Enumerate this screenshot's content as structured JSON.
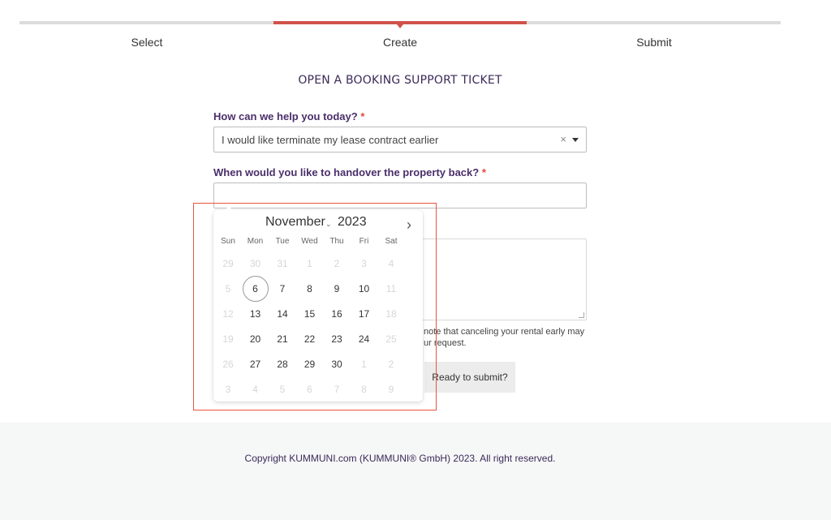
{
  "steps": [
    {
      "label": "Select",
      "active": false
    },
    {
      "label": "Create",
      "active": true
    },
    {
      "label": "Submit",
      "active": false
    }
  ],
  "colors": {
    "accent": "#d0524a",
    "heading": "#3b2a58",
    "label": "#4a2f6a",
    "required": "#e04a3a",
    "annotation": "#e8553e"
  },
  "form": {
    "title": "OPEN A BOOKING SUPPORT TICKET",
    "help_label": "How can we help you today?",
    "help_required": "*",
    "help_value": "I would like terminate my lease contract earlier",
    "help_clear_icon": "×",
    "handover_label": "When would you like to handover the property back?",
    "handover_required": "*",
    "handover_value": "",
    "note_text": "note that canceling your rental early may",
    "note_text_2": "ur request.",
    "submit_label": "Ready to submit?"
  },
  "calendar": {
    "month": "November",
    "month_caret": "⌄",
    "year": "2023",
    "next_icon": "›",
    "weekdays": [
      "Sun",
      "Mon",
      "Tue",
      "Wed",
      "Thu",
      "Fri",
      "Sat"
    ],
    "weeks": [
      [
        {
          "d": "29",
          "m": true
        },
        {
          "d": "30",
          "m": true
        },
        {
          "d": "31",
          "m": true
        },
        {
          "d": "1",
          "m": true
        },
        {
          "d": "2",
          "m": true
        },
        {
          "d": "3",
          "m": true
        },
        {
          "d": "4",
          "m": true
        }
      ],
      [
        {
          "d": "5",
          "m": true
        },
        {
          "d": "6",
          "m": false,
          "today": true
        },
        {
          "d": "7",
          "m": false
        },
        {
          "d": "8",
          "m": false
        },
        {
          "d": "9",
          "m": false
        },
        {
          "d": "10",
          "m": false
        },
        {
          "d": "11",
          "m": true
        }
      ],
      [
        {
          "d": "12",
          "m": true
        },
        {
          "d": "13",
          "m": false
        },
        {
          "d": "14",
          "m": false
        },
        {
          "d": "15",
          "m": false
        },
        {
          "d": "16",
          "m": false
        },
        {
          "d": "17",
          "m": false
        },
        {
          "d": "18",
          "m": true
        }
      ],
      [
        {
          "d": "19",
          "m": true
        },
        {
          "d": "20",
          "m": false
        },
        {
          "d": "21",
          "m": false
        },
        {
          "d": "22",
          "m": false
        },
        {
          "d": "23",
          "m": false
        },
        {
          "d": "24",
          "m": false
        },
        {
          "d": "25",
          "m": true
        }
      ],
      [
        {
          "d": "26",
          "m": true
        },
        {
          "d": "27",
          "m": false
        },
        {
          "d": "28",
          "m": false
        },
        {
          "d": "29",
          "m": false
        },
        {
          "d": "30",
          "m": false
        },
        {
          "d": "1",
          "m": true
        },
        {
          "d": "2",
          "m": true
        }
      ],
      [
        {
          "d": "3",
          "m": true
        },
        {
          "d": "4",
          "m": true
        },
        {
          "d": "5",
          "m": true
        },
        {
          "d": "6",
          "m": true
        },
        {
          "d": "7",
          "m": true
        },
        {
          "d": "8",
          "m": true
        },
        {
          "d": "9",
          "m": true
        }
      ]
    ]
  },
  "footer": {
    "copyright": "Copyright KUMMUNI.com (KUMMUNI® GmbH) 2023. All right reserved."
  }
}
